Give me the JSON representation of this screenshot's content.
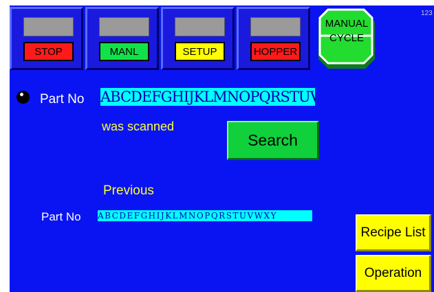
{
  "status_bar": {
    "tiles": [
      {
        "label": "STOP",
        "label_color": "#ff1a1a"
      },
      {
        "label": "MANL",
        "label_color": "#12e24a"
      },
      {
        "label": "SETUP",
        "label_color": "#ffff00"
      },
      {
        "label": "HOPPER",
        "label_color": "#ff1a1a"
      }
    ],
    "manual_cycle": {
      "label": "MANUAL\nCYCLE"
    },
    "corner_text": "123"
  },
  "scan": {
    "part_no_label": "Part No",
    "part_no_value": "ABCDEFGHIJKLMNOPQRSTUVWXY",
    "status_text": "was scanned",
    "search_label": "Search"
  },
  "previous": {
    "heading": "Previous",
    "part_no_label": "Part No",
    "part_no_value": "ABCDEFGHIJKLMNOPQRSTUVWXY"
  },
  "side_buttons": {
    "recipe_list": "Recipe List",
    "operation": "Operation"
  },
  "colors": {
    "background": "#0a14f2",
    "field": "#00ffff",
    "search_button": "#10d03c",
    "side_button": "#ffff00",
    "label_text": "#ffffff",
    "status_text": "#ffff3c"
  }
}
